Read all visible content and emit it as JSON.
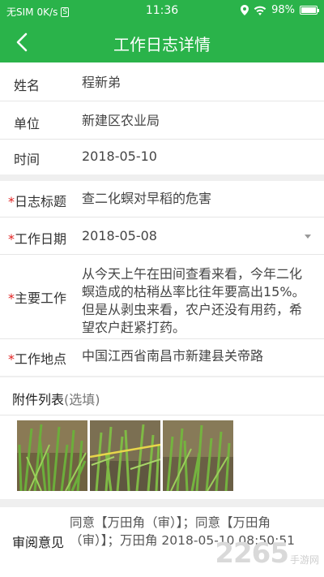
{
  "status_bar": {
    "carrier": "无SIM",
    "speed": "0K/s",
    "sim_icon_text": "S",
    "time": "11:36",
    "battery": "98%"
  },
  "nav": {
    "title": "工作日志详情"
  },
  "info": {
    "name_label": "姓名",
    "name": "程新弟",
    "unit_label": "单位",
    "unit": "新建区农业局",
    "time_label": "时间",
    "time": "2018-05-10"
  },
  "log": {
    "required_mark": "*",
    "title_label": "日志标题",
    "title": "查二化螟对早稻的危害",
    "date_label": "工作日期",
    "date": "2018-05-08",
    "main_label": "主要工作",
    "main": "从今天上午在田间查看来看，今年二化螟造成的枯稍丛率比往年要高出15%。但是从剥虫来看，农户还没有用药，希望农户赶紧打药。",
    "place_label": "工作地点",
    "place": "中国江西省南昌市新建县关帝路"
  },
  "attachments": {
    "label": "附件列表",
    "optional": "(选填)",
    "count": 3
  },
  "review": {
    "label": "审阅意见",
    "text": "同意【万田角（审）】；同意【万田角（审）】；万田角 2018-05-10 08:50:51"
  },
  "watermark": {
    "brand": "2265",
    "site": "手游网"
  },
  "colors": {
    "primary": "#2ab34a",
    "required": "#e02020"
  }
}
